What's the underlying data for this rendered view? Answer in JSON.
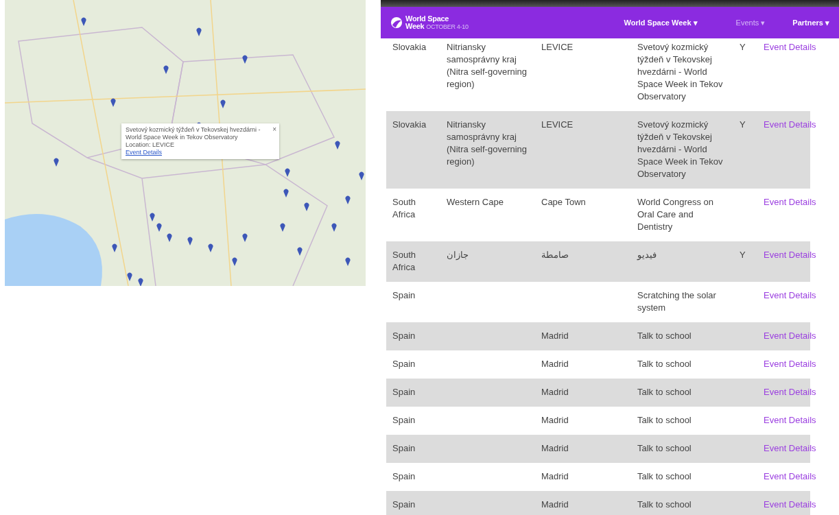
{
  "map": {
    "popup": {
      "title": "Svetový kozmický týždeň v Tekovskej hvezdárni - World Space Week in Tekov Observatory",
      "location": "Location: LEVICE",
      "link": "Event Details",
      "close": "×"
    }
  },
  "header": {
    "logo_title": "World Space",
    "logo_title_2": "Week",
    "logo_subtitle": "OCTOBER 4-10",
    "nav": [
      {
        "label": "World Space Week",
        "caret": "▾",
        "selected": false
      },
      {
        "label": "Events",
        "caret": "▾",
        "selected": true
      },
      {
        "label": "Partners",
        "caret": "▾",
        "selected": false
      }
    ]
  },
  "table": {
    "rows": [
      {
        "country": "Slovakia",
        "region": "Nitriansky samosprávny kraj (Nitra self-governing region)",
        "city": "LEVICE",
        "event": "Svetový kozmický týždeň v Tekovskej hvezdárni - World Space Week in Tekov Observatory",
        "column_5": "Y",
        "link": "Event Details"
      },
      {
        "country": "Slovakia",
        "region": "Nitriansky samosprávny kraj (Nitra self-governing region)",
        "city": "LEVICE",
        "event": "Svetový kozmický týždeň v Tekovskej hvezdárni - World Space Week in Tekov Observatory",
        "column_5": "Y",
        "link": "Event Details"
      },
      {
        "country": "South Africa",
        "region": "Western Cape",
        "city": "Cape Town",
        "event": "World Congress on Oral Care and Dentistry",
        "link": "Event Details"
      },
      {
        "country": "South Africa",
        "region": "جازان",
        "city": "صامطة",
        "event": "فيديو",
        "column_5": "Y",
        "link": "Event Details"
      },
      {
        "country": "Spain",
        "event": "Scratching the solar system",
        "link": "Event Details"
      },
      {
        "country": "Spain",
        "city": "Madrid",
        "event": "Talk to school",
        "link": "Event Details"
      },
      {
        "country": "Spain",
        "city": "Madrid",
        "event": "Talk to school",
        "link": "Event Details"
      },
      {
        "country": "Spain",
        "city": "Madrid",
        "event": "Talk to school",
        "link": "Event Details"
      },
      {
        "country": "Spain",
        "city": "Madrid",
        "event": "Talk to school",
        "link": "Event Details"
      },
      {
        "country": "Spain",
        "city": "Madrid",
        "event": "Talk to school",
        "link": "Event Details"
      },
      {
        "country": "Spain",
        "city": "Madrid",
        "event": "Talk to school",
        "link": "Event Details"
      },
      {
        "country": "Spain",
        "city": "Madrid",
        "event": "Talk to school",
        "link": "Event Details"
      }
    ]
  }
}
